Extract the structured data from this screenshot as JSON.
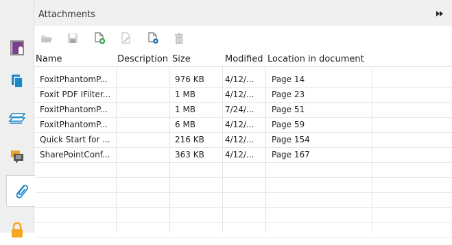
{
  "panel": {
    "title": "Attachments"
  },
  "sidebar": {
    "items": [
      {
        "icon": "bookmark-icon"
      },
      {
        "icon": "pages-icon"
      },
      {
        "icon": "layers-icon"
      },
      {
        "icon": "comments-icon"
      },
      {
        "icon": "attachment-icon",
        "active": true
      },
      {
        "icon": "security-icon"
      }
    ]
  },
  "toolbar": {
    "buttons": [
      "open-icon",
      "save-icon",
      "add-file-icon",
      "edit-description-icon",
      "settings-icon",
      "delete-icon"
    ]
  },
  "table": {
    "columns": [
      "Name",
      "Description",
      "Size",
      "Modified",
      "Location in document"
    ],
    "rows": [
      {
        "name": "FoxitPhantomP...",
        "description": "",
        "size": "976 KB",
        "modified": "4/12/...",
        "location": "Page 14"
      },
      {
        "name": "Foxit PDF IFilter...",
        "description": "",
        "size": "1 MB",
        "modified": "4/12/...",
        "location": "Page 23"
      },
      {
        "name": "FoxitPhantomP...",
        "description": "",
        "size": "1 MB",
        "modified": "7/24/...",
        "location": "Page 51"
      },
      {
        "name": "FoxitPhantomP...",
        "description": "",
        "size": "6 MB",
        "modified": "4/12/...",
        "location": "Page 59"
      },
      {
        "name": "Quick Start for ...",
        "description": "",
        "size": "216 KB",
        "modified": "4/12/...",
        "location": "Page 154"
      },
      {
        "name": "SharePointConf...",
        "description": "",
        "size": "363 KB",
        "modified": "4/12/...",
        "location": "Page 167"
      }
    ]
  },
  "colors": {
    "accent_blue": "#1e88c8",
    "bookmark_purple": "#7b3f8c",
    "comment_orange": "#f0a020",
    "lock_orange": "#f5a623"
  }
}
